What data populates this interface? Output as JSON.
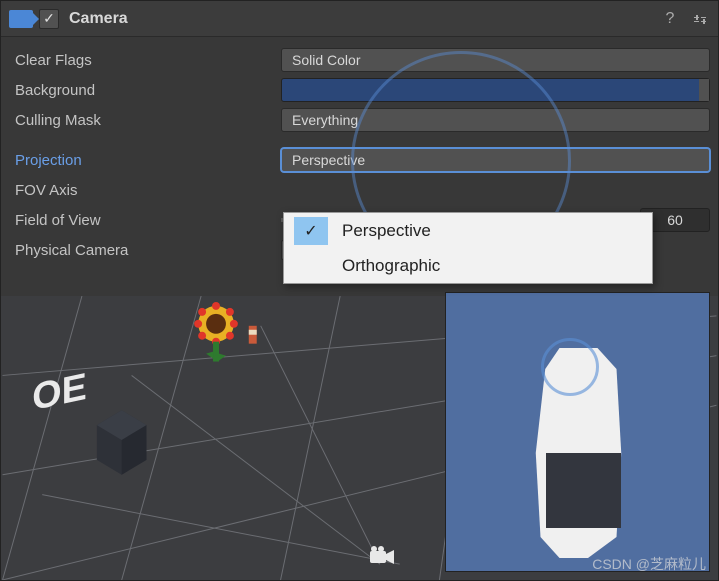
{
  "header": {
    "title": "Camera",
    "enabled_check": "✓"
  },
  "fields": {
    "clear_flags": {
      "label": "Clear Flags",
      "value": "Solid Color"
    },
    "background": {
      "label": "Background",
      "color": "#2b4778"
    },
    "culling_mask": {
      "label": "Culling Mask",
      "value": "Everything"
    },
    "projection": {
      "label": "Projection",
      "value": "Perspective"
    },
    "fov_axis": {
      "label": "FOV Axis"
    },
    "field_of_view": {
      "label": "Field of View",
      "value": "60"
    },
    "physical_camera": {
      "label": "Physical Camera"
    }
  },
  "projection_options": {
    "opt1": "Perspective",
    "opt2": "Orthographic",
    "check": "✓"
  },
  "watermark": "CSDN @芝麻粒儿"
}
